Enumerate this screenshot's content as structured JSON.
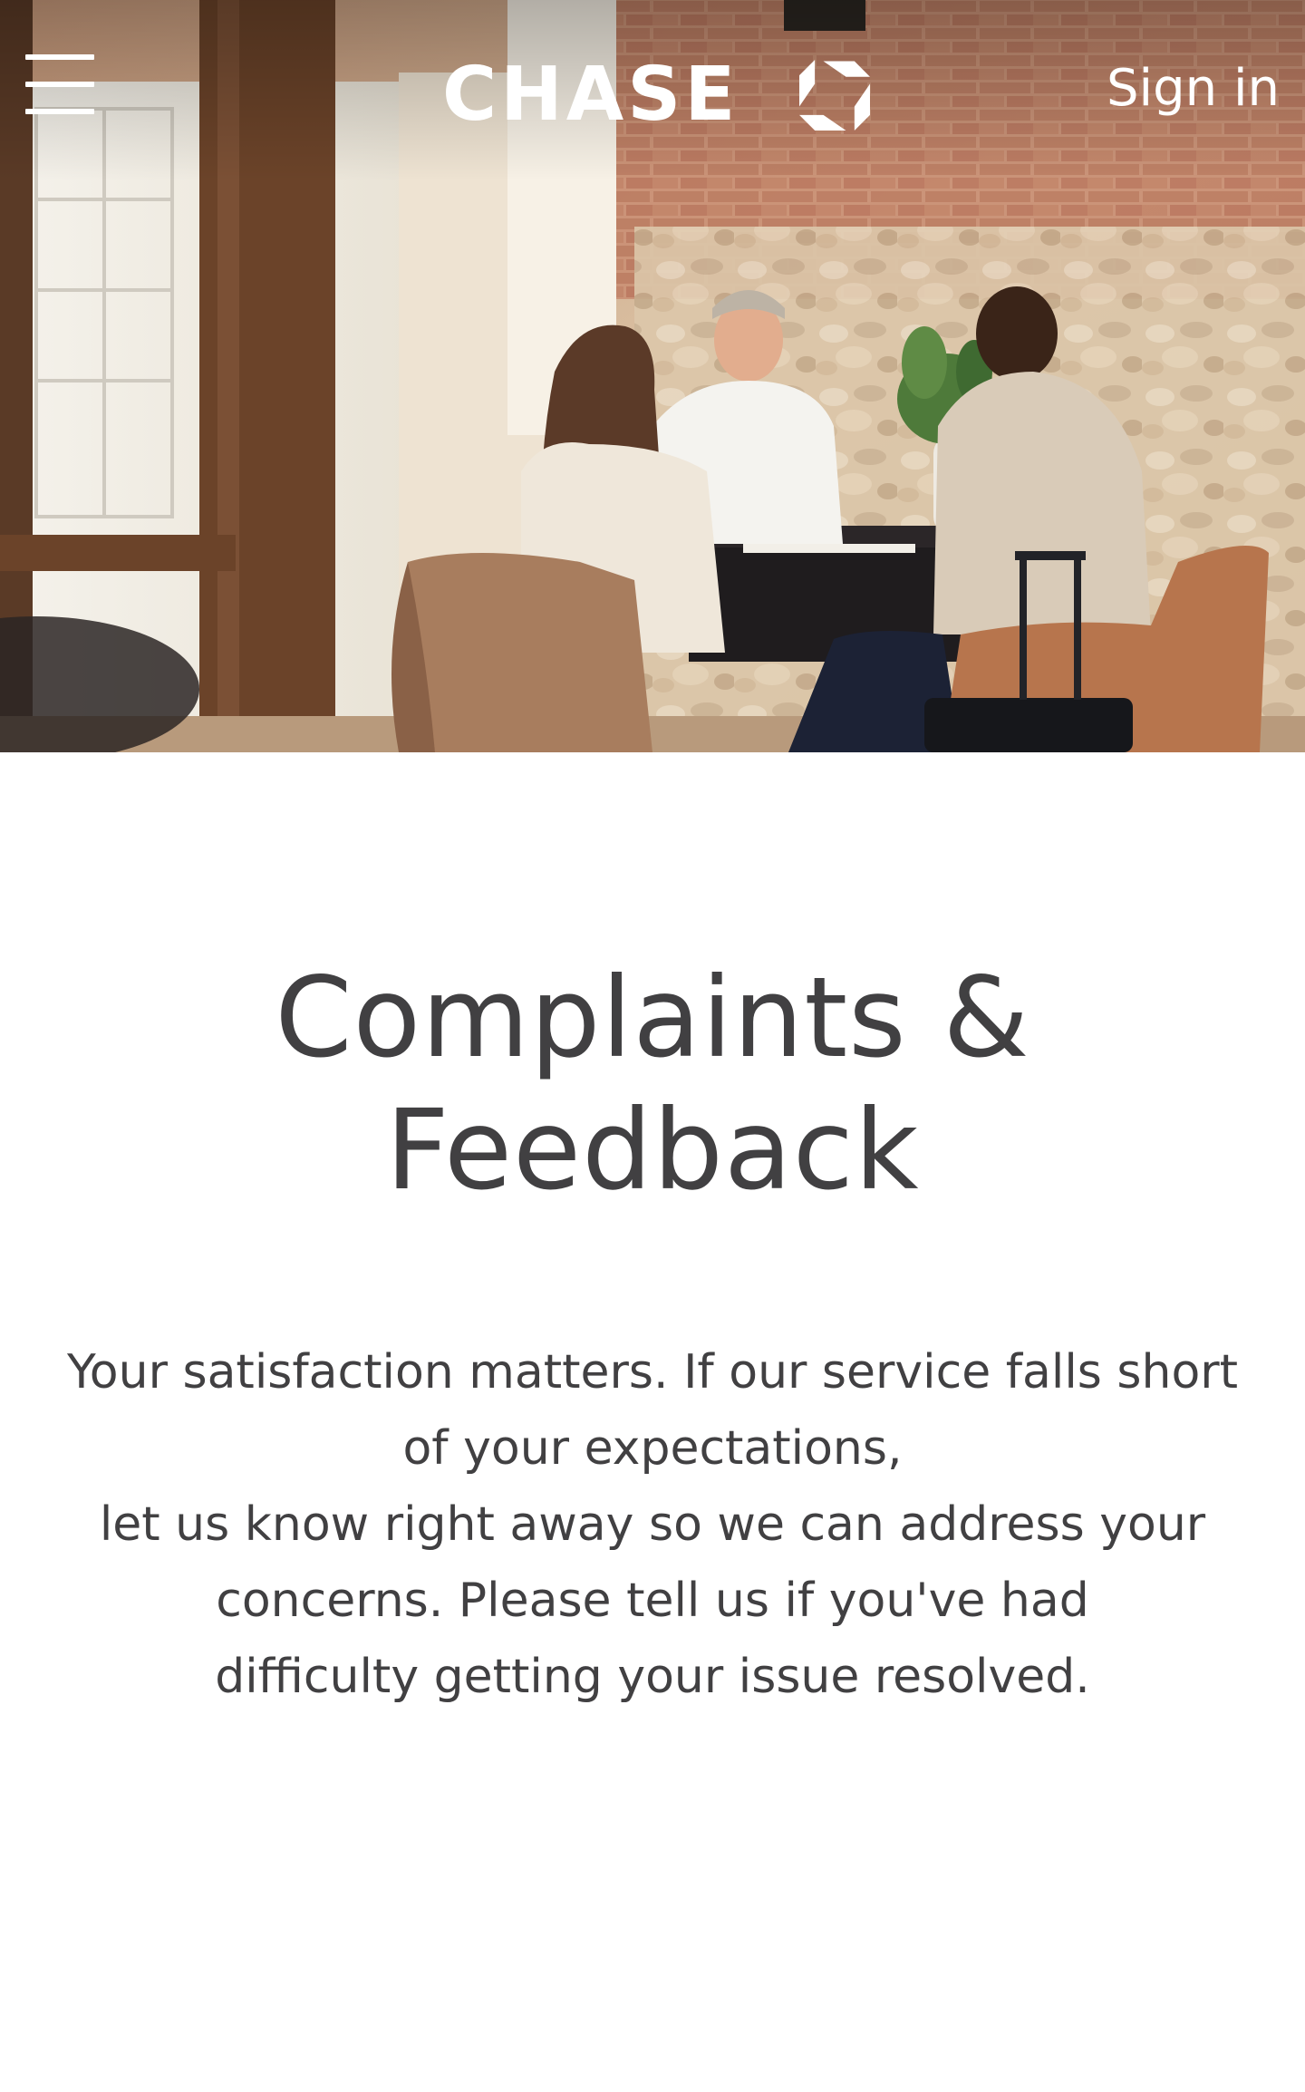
{
  "header": {
    "menu_icon": "hamburger-menu-icon",
    "brand_name": "CHASE",
    "brand_icon": "chase-octagon-logo-icon",
    "signin_label": "Sign in"
  },
  "hero": {
    "image_subject": "two customers meeting with a banker at a desk by a brick wall"
  },
  "main": {
    "title": "Complaints & Feedback",
    "intro_lines": [
      "Your satisfaction matters. If our service falls short",
      "of your expectations,",
      "let us know right away so we can address your",
      "concerns. Please tell us if you've had",
      "difficulty getting your issue resolved."
    ]
  },
  "colors": {
    "text": "#414042",
    "header_text": "#ffffff",
    "background": "#ffffff"
  }
}
